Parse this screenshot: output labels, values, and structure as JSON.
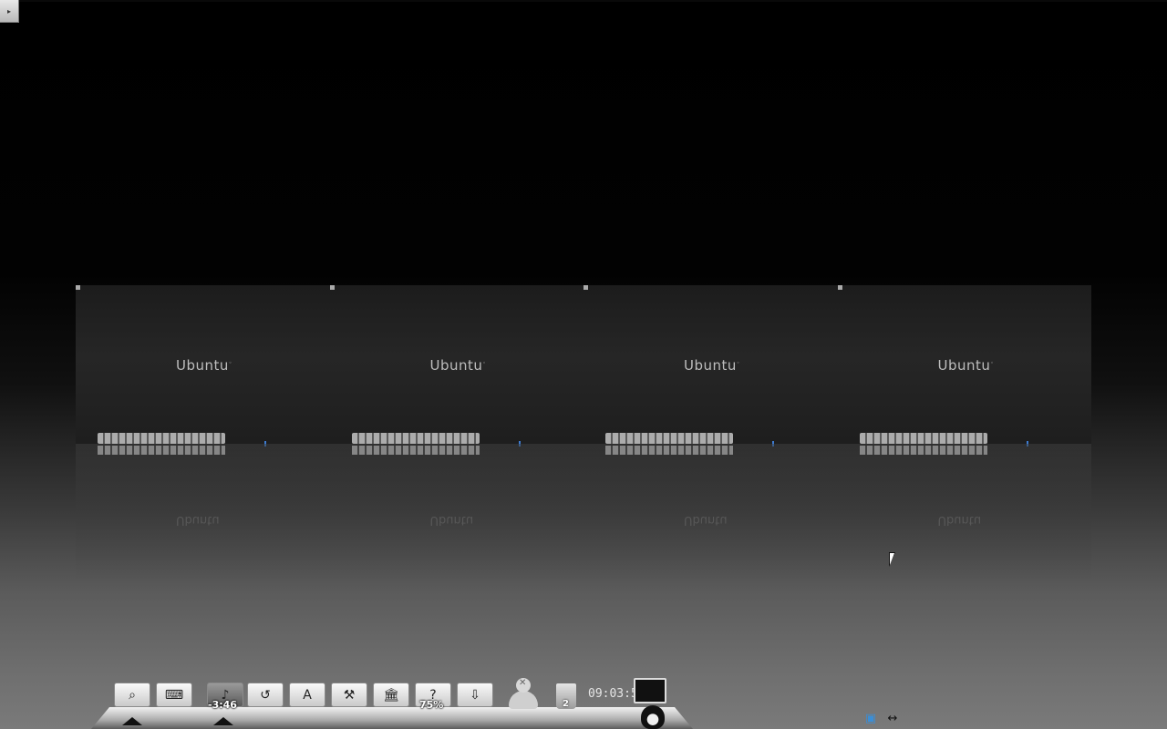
{
  "desktop": {
    "corner_toggle_icon": "triangle-right-icon"
  },
  "workspaces": [
    {
      "label": "Ubuntu"
    },
    {
      "label": "Ubuntu"
    },
    {
      "label": "Ubuntu"
    },
    {
      "label": "Ubuntu"
    }
  ],
  "dock": {
    "items": [
      {
        "name": "search-launcher",
        "icon": "magnifier-icon",
        "glyph": "⌕"
      },
      {
        "name": "keyboard-launcher",
        "icon": "keyboard-pen-icon",
        "glyph": "⌨"
      },
      {
        "name": "music-player",
        "icon": "music-note-icon",
        "glyph": "♪",
        "badge": "-3:46"
      },
      {
        "name": "history-launcher",
        "icon": "clock-history-icon",
        "glyph": "↺"
      },
      {
        "name": "app-store-launcher",
        "icon": "app-store-a-icon",
        "glyph": "A"
      },
      {
        "name": "tools-launcher",
        "icon": "hammer-icon",
        "glyph": "⚒"
      },
      {
        "name": "bank-launcher",
        "icon": "bank-building-icon",
        "glyph": "🏛"
      },
      {
        "name": "help-launcher",
        "icon": "question-mark-icon",
        "glyph": "?",
        "badge": "75%"
      },
      {
        "name": "downloads-launcher",
        "icon": "download-arrow-icon",
        "glyph": "⇩"
      }
    ],
    "trash_count": "2",
    "clock": "09:03:52"
  },
  "tray": {
    "icons": [
      "network-icon",
      "arrows-left-right-icon"
    ],
    "glyphs": [
      "▣",
      "↔"
    ]
  }
}
